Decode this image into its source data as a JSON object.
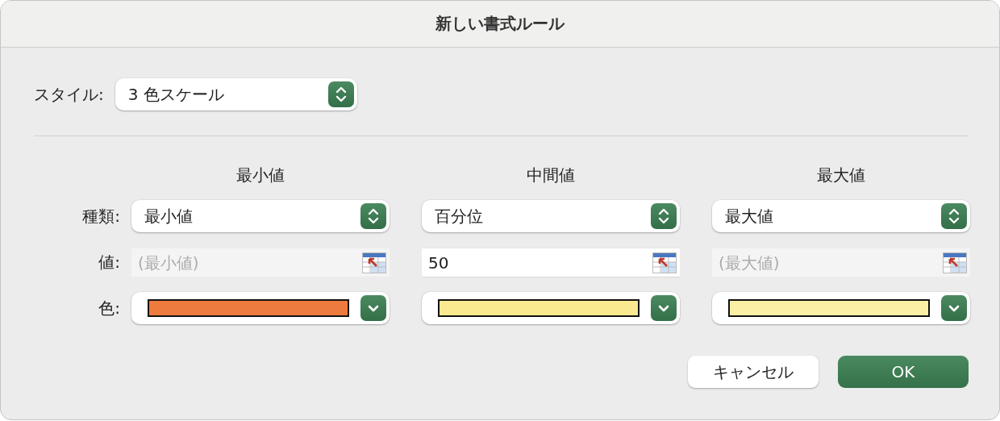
{
  "window": {
    "title": "新しい書式ルール"
  },
  "style": {
    "label": "スタイル:",
    "value": "3 色スケール"
  },
  "row_labels": [
    "種類:",
    "値:",
    "色:"
  ],
  "columns": [
    {
      "heading": "最小値",
      "type": "最小値",
      "value_field": {
        "placeholder": "(最小値)",
        "disabled": true
      },
      "color": "#ee7b3e"
    },
    {
      "heading": "中間値",
      "type": "百分位",
      "value_field": {
        "value": "50",
        "disabled": false
      },
      "color": "#fbe98f"
    },
    {
      "heading": "最大値",
      "type": "最大値",
      "value_field": {
        "placeholder": "(最大値)",
        "disabled": true
      },
      "color": "#fbefa6"
    }
  ],
  "buttons": [
    {
      "label": "キャンセル",
      "kind": "secondary"
    },
    {
      "label": "OK",
      "kind": "primary"
    }
  ]
}
